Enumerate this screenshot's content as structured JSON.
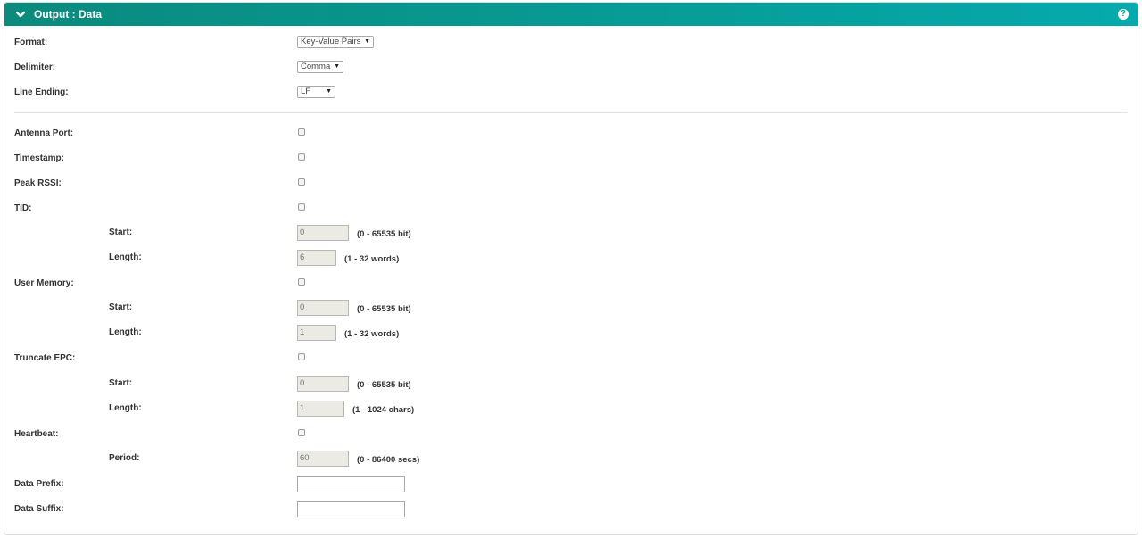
{
  "panel": {
    "title": "Output : Data",
    "help_label": "?"
  },
  "format": {
    "label": "Format:",
    "value": "Key-Value Pairs"
  },
  "delimiter": {
    "label": "Delimiter:",
    "value": "Comma"
  },
  "line_ending": {
    "label": "Line Ending:",
    "value": "LF"
  },
  "antenna_port": {
    "label": "Antenna Port:"
  },
  "timestamp": {
    "label": "Timestamp:"
  },
  "peak_rssi": {
    "label": "Peak RSSI:"
  },
  "tid": {
    "label": "TID:",
    "start": {
      "label": "Start:",
      "value": "0",
      "hint": "(0 - 65535 bit)"
    },
    "length": {
      "label": "Length:",
      "value": "6",
      "hint": "(1 - 32 words)"
    }
  },
  "user_memory": {
    "label": "User Memory:",
    "start": {
      "label": "Start:",
      "value": "0",
      "hint": "(0 - 65535 bit)"
    },
    "length": {
      "label": "Length:",
      "value": "1",
      "hint": "(1 - 32 words)"
    }
  },
  "truncate_epc": {
    "label": "Truncate EPC:",
    "start": {
      "label": "Start:",
      "value": "0",
      "hint": "(0 - 65535 bit)"
    },
    "length": {
      "label": "Length:",
      "value": "1",
      "hint": "(1 - 1024 chars)"
    }
  },
  "heartbeat": {
    "label": "Heartbeat:",
    "period": {
      "label": "Period:",
      "value": "60",
      "hint": "(0 - 86400 secs)"
    }
  },
  "data_prefix": {
    "label": "Data Prefix:",
    "value": ""
  },
  "data_suffix": {
    "label": "Data Suffix:",
    "value": ""
  },
  "colors": {
    "header_start": "#0b8a7d",
    "header_end": "#06aaad"
  }
}
